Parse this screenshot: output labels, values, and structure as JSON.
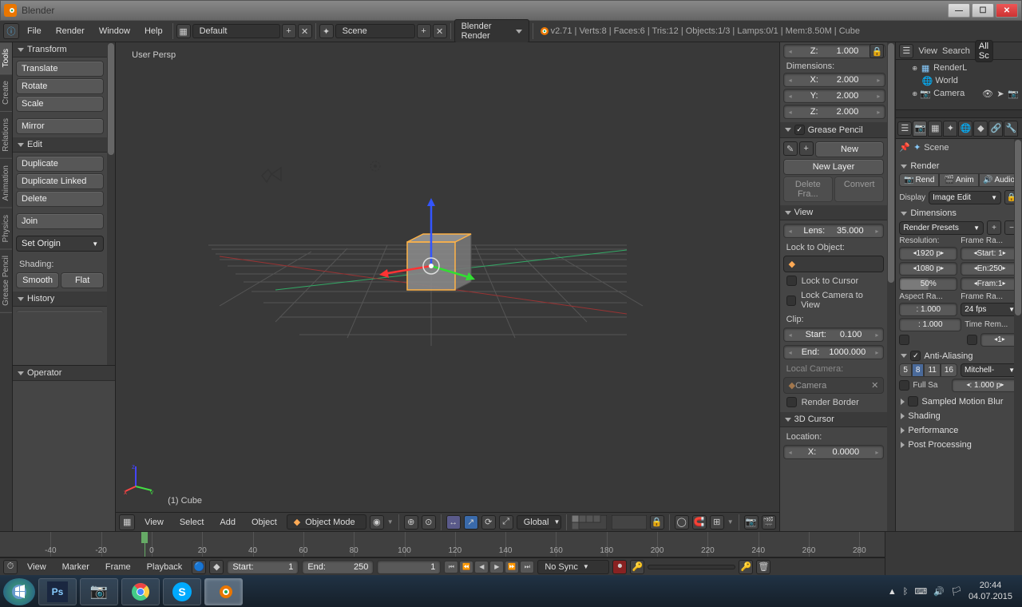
{
  "window": {
    "title": "Blender"
  },
  "menubar": {
    "items": [
      "File",
      "Render",
      "Window",
      "Help"
    ],
    "layout_dropdown": "Default",
    "scene_dropdown": "Scene",
    "engine_dropdown": "Blender Render",
    "status": "v2.71 | Verts:8 | Faces:6 | Tris:12 | Objects:1/3 | Lamps:0/1 | Mem:8.50M | Cube"
  },
  "left_tabs": [
    "Tools",
    "Create",
    "Relations",
    "Animation",
    "Physics",
    "Grease Pencil"
  ],
  "tools_panel": {
    "transform": {
      "header": "Transform",
      "translate": "Translate",
      "rotate": "Rotate",
      "scale": "Scale",
      "mirror": "Mirror"
    },
    "edit": {
      "header": "Edit",
      "duplicate": "Duplicate",
      "dup_linked": "Duplicate Linked",
      "delete": "Delete",
      "join": "Join",
      "set_origin": "Set Origin"
    },
    "shading": {
      "label": "Shading:",
      "smooth": "Smooth",
      "flat": "Flat"
    },
    "history": {
      "header": "History"
    },
    "operator": {
      "header": "Operator"
    }
  },
  "viewport": {
    "persp": "User Persp",
    "obj_label": "(1) Cube"
  },
  "viewport_header": {
    "view": "View",
    "select": "Select",
    "add": "Add",
    "object": "Object",
    "mode": "Object Mode",
    "orientation": "Global"
  },
  "npanel": {
    "dim_label": "Dimensions:",
    "dim_z_top": {
      "label": "Z:",
      "value": "1.000"
    },
    "dim_x": {
      "label": "X:",
      "value": "2.000"
    },
    "dim_y": {
      "label": "Y:",
      "value": "2.000"
    },
    "dim_z": {
      "label": "Z:",
      "value": "2.000"
    },
    "grease": {
      "header": "Grease Pencil",
      "new": "New",
      "new_layer": "New Layer",
      "delete_frame": "Delete Fra...",
      "convert": "Convert"
    },
    "view": {
      "header": "View",
      "lens_label": "Lens:",
      "lens_value": "35.000",
      "lock_obj": "Lock to Object:",
      "lock_cursor": "Lock to Cursor",
      "lock_cam": "Lock Camera to View",
      "clip": "Clip:",
      "start_label": "Start:",
      "start_val": "0.100",
      "end_label": "End:",
      "end_val": "1000.000",
      "local_cam": "Local Camera:",
      "camera": "Camera",
      "render_border": "Render Border"
    },
    "cursor": {
      "header": "3D Cursor",
      "location": "Location:",
      "x_label": "X:",
      "x_val": "0.0000"
    }
  },
  "outliner": {
    "header": {
      "view": "View",
      "search": "Search",
      "all": "All Sc"
    },
    "items": [
      {
        "name": "RenderL"
      },
      {
        "name": "World"
      },
      {
        "name": "Camera"
      }
    ]
  },
  "properties": {
    "breadcrumb": "Scene",
    "render": {
      "header": "Render",
      "render_btn": "Rend",
      "anim_btn": "Anim",
      "audio_btn": "Audio",
      "display_label": "Display",
      "display_val": "Image Edit"
    },
    "dimensions": {
      "header": "Dimensions",
      "presets": "Render Presets",
      "res_label": "Resolution:",
      "fr_label": "Frame Ra...",
      "res_x": "1920 p",
      "res_y": "1080 p",
      "res_pct": "50%",
      "start": "Start: 1",
      "end": "En:250",
      "frame": "Fram:1",
      "aspect_label": "Aspect Ra...",
      "fr2_label": "Frame Ra...",
      "asp_x": ": 1.000",
      "asp_y": ": 1.000",
      "fps": "24 fps",
      "time_rem": "Time Rem...",
      "one": "1"
    },
    "aa": {
      "header": "Anti-Aliasing",
      "s5": "5",
      "s8": "8",
      "s11": "11",
      "s16": "16",
      "mitchell": "Mitchell-",
      "fullsa": "Full Sa",
      "size": ": 1.000 p"
    },
    "motion": "Sampled Motion Blur",
    "shading_h": "Shading",
    "perf_h": "Performance",
    "post_h": "Post Processing"
  },
  "timeline": {
    "ticks": [
      -40,
      -20,
      0,
      20,
      40,
      60,
      80,
      100,
      120,
      140,
      160,
      180,
      200,
      220,
      240,
      260,
      280
    ],
    "playhead": 0,
    "header": {
      "view": "View",
      "marker": "Marker",
      "frame": "Frame",
      "playback": "Playback",
      "start_label": "Start:",
      "start_val": "1",
      "end_label": "End:",
      "end_val": "250",
      "cur": "1",
      "sync": "No Sync"
    }
  },
  "taskbar": {
    "time": "20:44",
    "date": "04.07.2015"
  }
}
